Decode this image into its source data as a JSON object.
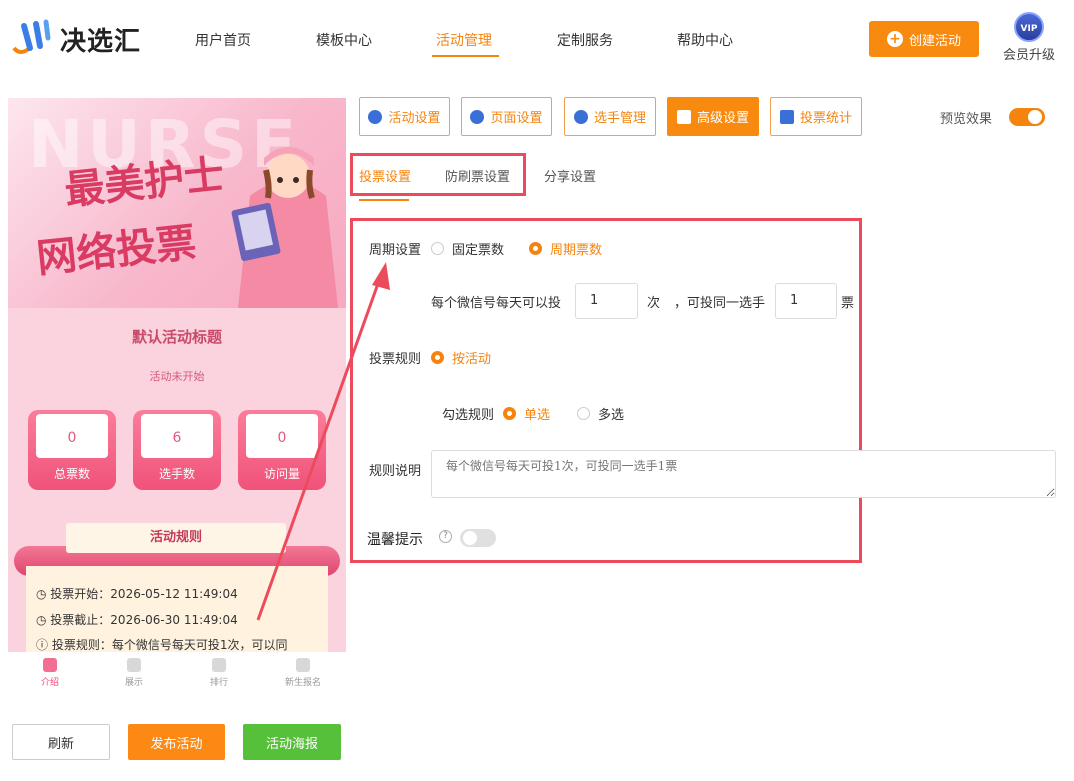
{
  "brand": {
    "name": "决选汇"
  },
  "nav": {
    "items": [
      {
        "label": "用户首页",
        "active": false
      },
      {
        "label": "模板中心",
        "active": false
      },
      {
        "label": "活动管理",
        "active": true
      },
      {
        "label": "定制服务",
        "active": false
      },
      {
        "label": "帮助中心",
        "active": false
      }
    ],
    "create_label": "创建活动",
    "vip_badge": "VIP",
    "vip_label": "会员升级"
  },
  "preview": {
    "banner_bg": "NURSE",
    "banner_line1": "最美护士",
    "banner_line2": "网络投票",
    "title": "默认活动标题",
    "status": "活动未开始",
    "stats": [
      {
        "value": "0",
        "label": "总票数"
      },
      {
        "value": "6",
        "label": "选手数"
      },
      {
        "value": "0",
        "label": "访问量"
      }
    ],
    "rules_title": "活动规则",
    "rules": [
      "投票开始：2026-05-12 11:49:04",
      "投票截止：2026-06-30 11:49:04",
      "投票规则：每个微信号每天可投1次，可以同"
    ],
    "tabbar": [
      {
        "label": "介绍",
        "active": true
      },
      {
        "label": "展示",
        "active": false
      },
      {
        "label": "排行",
        "active": false
      },
      {
        "label": "新生报名",
        "active": false
      }
    ]
  },
  "bottom_buttons": {
    "refresh": "刷新",
    "publish": "发布活动",
    "poster": "活动海报"
  },
  "toolbar": {
    "buttons": [
      {
        "label": "活动设置",
        "icon": "star-icon",
        "active": false
      },
      {
        "label": "页面设置",
        "icon": "gear-icon",
        "active": false
      },
      {
        "label": "选手管理",
        "icon": "users-icon",
        "active": false
      },
      {
        "label": "高级设置",
        "icon": "settings-icon",
        "active": true
      },
      {
        "label": "投票统计",
        "icon": "chart-icon",
        "active": false
      }
    ],
    "preview_label": "预览效果",
    "preview_on": true
  },
  "subtabs": [
    {
      "label": "投票设置",
      "active": true
    },
    {
      "label": "防刷票设置",
      "active": false
    },
    {
      "label": "分享设置",
      "active": false
    }
  ],
  "form": {
    "period_label": "周期设置",
    "period_options": [
      "固定票数",
      "周期票数"
    ],
    "period_selected": "周期票数",
    "daily_prefix": "每个微信号每天可以投",
    "daily_value": "1",
    "daily_unit": "次",
    "same_prefix": "，可投同一选手",
    "same_value": "1",
    "same_unit": "票",
    "rule_label": "投票规则",
    "rule_option": "按活动",
    "check_label": "勾选规则",
    "check_options": [
      "单选",
      "多选"
    ],
    "check_selected": "单选",
    "desc_label": "规则说明",
    "desc_placeholder": "每个微信号每天可投1次，可投同一选手1票",
    "tip_label": "温馨提示",
    "tip_on": false
  },
  "colors": {
    "accent": "#f98a10",
    "highlight": "#ec4b5c",
    "pink": "#f0527a",
    "green": "#57c03a"
  }
}
